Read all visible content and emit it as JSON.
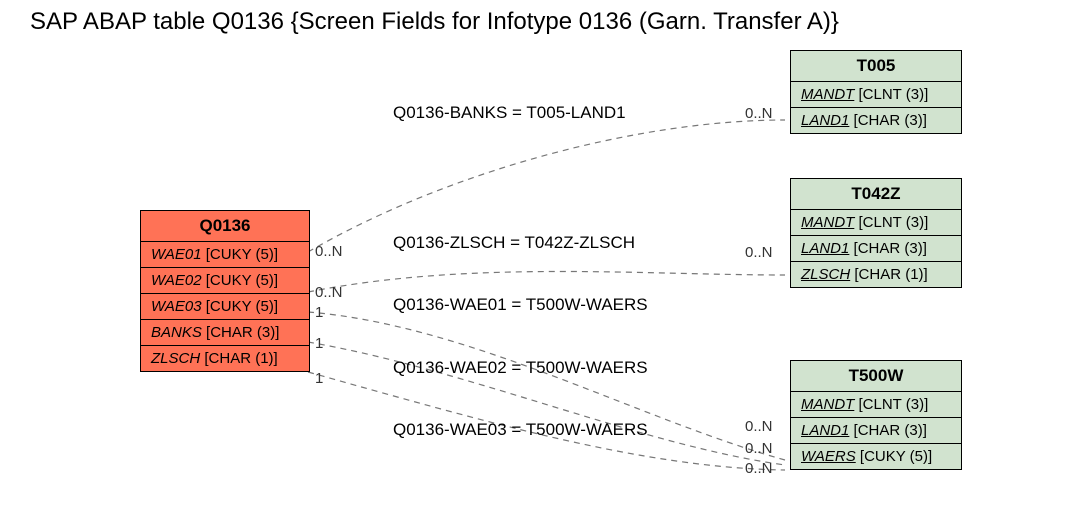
{
  "title": "SAP ABAP table Q0136 {Screen Fields for Infotype 0136 (Garn. Transfer A)}",
  "mainTable": {
    "name": "Q0136",
    "fields": [
      {
        "name": "WAE01",
        "type": "[CUKY (5)]"
      },
      {
        "name": "WAE02",
        "type": "[CUKY (5)]"
      },
      {
        "name": "WAE03",
        "type": "[CUKY (5)]"
      },
      {
        "name": "BANKS",
        "type": "[CHAR (3)]"
      },
      {
        "name": "ZLSCH",
        "type": "[CHAR (1)]"
      }
    ]
  },
  "refTables": [
    {
      "name": "T005",
      "fields": [
        {
          "name": "MANDT",
          "type": "[CLNT (3)]",
          "pk": true
        },
        {
          "name": "LAND1",
          "type": "[CHAR (3)]",
          "pk": true
        }
      ]
    },
    {
      "name": "T042Z",
      "fields": [
        {
          "name": "MANDT",
          "type": "[CLNT (3)]",
          "pk": true
        },
        {
          "name": "LAND1",
          "type": "[CHAR (3)]",
          "pk": true
        },
        {
          "name": "ZLSCH",
          "type": "[CHAR (1)]",
          "pk": true
        }
      ]
    },
    {
      "name": "T500W",
      "fields": [
        {
          "name": "MANDT",
          "type": "[CLNT (3)]",
          "pk": true
        },
        {
          "name": "LAND1",
          "type": "[CHAR (3)]",
          "pk": true
        },
        {
          "name": "WAERS",
          "type": "[CUKY (5)]",
          "pk": true
        }
      ]
    }
  ],
  "relations": [
    {
      "text": "Q0136-BANKS = T005-LAND1"
    },
    {
      "text": "Q0136-ZLSCH = T042Z-ZLSCH"
    },
    {
      "text": "Q0136-WAE01 = T500W-WAERS"
    },
    {
      "text": "Q0136-WAE02 = T500W-WAERS"
    },
    {
      "text": "Q0136-WAE03 = T500W-WAERS"
    }
  ],
  "cardLeft": [
    "0..N",
    "0..N",
    "1",
    "1",
    "1"
  ],
  "cardRight": [
    "0..N",
    "0..N",
    "0..N",
    "0..N",
    "0..N"
  ]
}
